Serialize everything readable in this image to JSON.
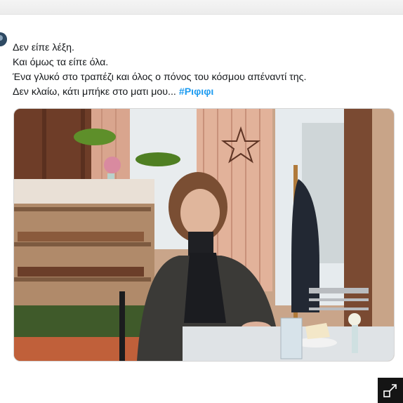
{
  "tweet": {
    "lines": [
      "Δεν είπε λέξη.",
      "Και όμως τα είπε όλα.",
      "Ένα γλυκό στο τραπέζι και όλος ο πόνος του κόσμου απέναντί της.",
      "Δεν κλαίω, κάτι μπήκε στο ματι μου..."
    ],
    "hashtag": "#Ριφιφι"
  },
  "icons": {
    "avatar": "avatar",
    "expand": "expand-icon"
  },
  "colors": {
    "text": "#14171a",
    "hashtag": "#1d9bf0",
    "expand_button_bg": "#141414"
  }
}
